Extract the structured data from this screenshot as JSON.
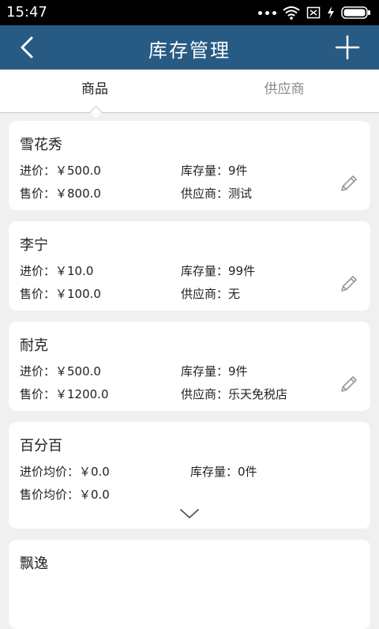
{
  "status": {
    "time": "15:47"
  },
  "header": {
    "title": "库存管理"
  },
  "tabs": [
    {
      "label": "商品"
    },
    {
      "label": "供应商"
    }
  ],
  "products": [
    {
      "name": "雪花秀",
      "buy": "进价：￥500.0",
      "sell": "售价：￥800.0",
      "stock": "库存量：9件",
      "supplier": "供应商：测试"
    },
    {
      "name": "李宁",
      "buy": "进价：￥10.0",
      "sell": "售价：￥100.0",
      "stock": "库存量：99件",
      "supplier": "供应商：无"
    },
    {
      "name": "耐克",
      "buy": "进价：￥500.0",
      "sell": "售价：￥1200.0",
      "stock": "库存量：9件",
      "supplier": "供应商：乐天免税店"
    },
    {
      "name": "百分百",
      "buy": "进价均价：￥0.0",
      "sell": "售价均价：￥0.0",
      "stock": "库存量：0件"
    },
    {
      "name": "飘逸"
    }
  ],
  "icons": {
    "back": "chevron-left-icon",
    "add": "plus-icon",
    "edit": "pencil-icon",
    "expand": "chevron-down-icon"
  },
  "colors": {
    "appbar": "#285b83",
    "background": "#f0f0f0"
  }
}
